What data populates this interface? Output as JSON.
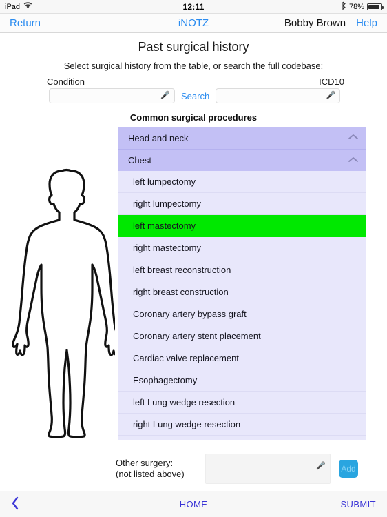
{
  "statusbar": {
    "device": "iPad",
    "wifi_icon": "wifi-icon",
    "time": "12:11",
    "bluetooth_icon": "bluetooth-icon",
    "battery_percent": "78%"
  },
  "navbar": {
    "return_label": "Return",
    "app_title": "iNOTZ",
    "user_name": "Bobby Brown",
    "help_label": "Help"
  },
  "page": {
    "title": "Past surgical history",
    "subtitle": "Select surgical history from the table, or search the full codebase:",
    "section_title": "Common surgical procedures"
  },
  "search": {
    "condition_label": "Condition",
    "icd_label": "ICD10",
    "search_link": "Search",
    "condition_value": "",
    "condition_placeholder": "",
    "icd_value": "",
    "icd_placeholder": "",
    "mic_icon": "microphone-icon"
  },
  "figure": {
    "name": "human-body-silhouette"
  },
  "list": {
    "groups": [
      {
        "label": "Head and neck",
        "expanded": true,
        "chevron": "chevron-up-icon"
      },
      {
        "label": "Chest",
        "expanded": true,
        "chevron": "chevron-up-icon"
      }
    ],
    "procedures": [
      {
        "label": "left lumpectomy",
        "selected": false
      },
      {
        "label": "right lumpectomy",
        "selected": false
      },
      {
        "label": "left mastectomy",
        "selected": true
      },
      {
        "label": "right mastectomy",
        "selected": false
      },
      {
        "label": "left breast reconstruction",
        "selected": false
      },
      {
        "label": "right breast construction",
        "selected": false
      },
      {
        "label": "Coronary artery bypass graft",
        "selected": false
      },
      {
        "label": "Coronary artery stent placement",
        "selected": false
      },
      {
        "label": "Cardiac valve replacement",
        "selected": false
      },
      {
        "label": "Esophagectomy",
        "selected": false
      },
      {
        "label": "left Lung wedge resection",
        "selected": false
      },
      {
        "label": "right Lung wedge resection",
        "selected": false
      }
    ]
  },
  "other": {
    "label_line1": "Other surgery:",
    "label_line2": "(not listed above)",
    "value": "",
    "placeholder": "",
    "add_label": "Add",
    "mic_icon": "microphone-icon"
  },
  "toolbar": {
    "back_icon": "chevron-left-icon",
    "home_label": "HOME",
    "submit_label": "SUBMIT"
  },
  "colors": {
    "accent_blue": "#2b8cf0",
    "toolbar_purple": "#3b35d6",
    "group_header": "#c3c0f5",
    "row_bg": "#e8e7fb",
    "selected_green": "#00e800",
    "add_button": "#29a5e0"
  }
}
